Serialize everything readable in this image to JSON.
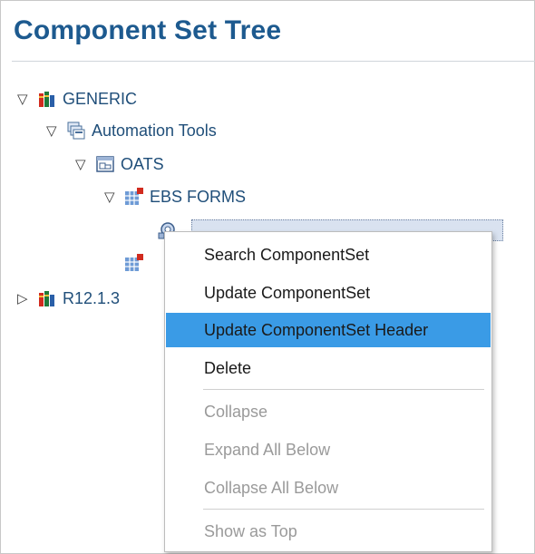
{
  "page": {
    "title": "Component Set Tree"
  },
  "tree": {
    "nodes": [
      {
        "label": "GENERIC",
        "toggle": "▽",
        "icon": "bookshelf-icon"
      },
      {
        "label": "Automation Tools",
        "toggle": "▽",
        "icon": "stacked-windows-icon"
      },
      {
        "label": "OATS",
        "toggle": "▽",
        "icon": "window-icon"
      },
      {
        "label": "EBS FORMS",
        "toggle": "▽",
        "icon": "grid-form-icon"
      },
      {
        "label": "R12.1.3",
        "toggle": "▷",
        "icon": "bookshelf-icon"
      }
    ]
  },
  "context_menu": {
    "items": [
      {
        "label": "Search ComponentSet",
        "enabled": true,
        "highlighted": false
      },
      {
        "label": "Update ComponentSet",
        "enabled": true,
        "highlighted": false
      },
      {
        "label": "Update ComponentSet Header",
        "enabled": true,
        "highlighted": true
      },
      {
        "label": "Delete",
        "enabled": true,
        "highlighted": false
      },
      {
        "label": "Collapse",
        "enabled": false,
        "highlighted": false
      },
      {
        "label": "Expand All Below",
        "enabled": false,
        "highlighted": false
      },
      {
        "label": "Collapse All Below",
        "enabled": false,
        "highlighted": false
      },
      {
        "label": "Show as Top",
        "enabled": false,
        "highlighted": false
      }
    ]
  },
  "colors": {
    "title": "#1d5a8f",
    "node_label": "#1f4e79",
    "menu_highlight": "#3a9be6",
    "disabled_text": "#9a9a9a"
  }
}
